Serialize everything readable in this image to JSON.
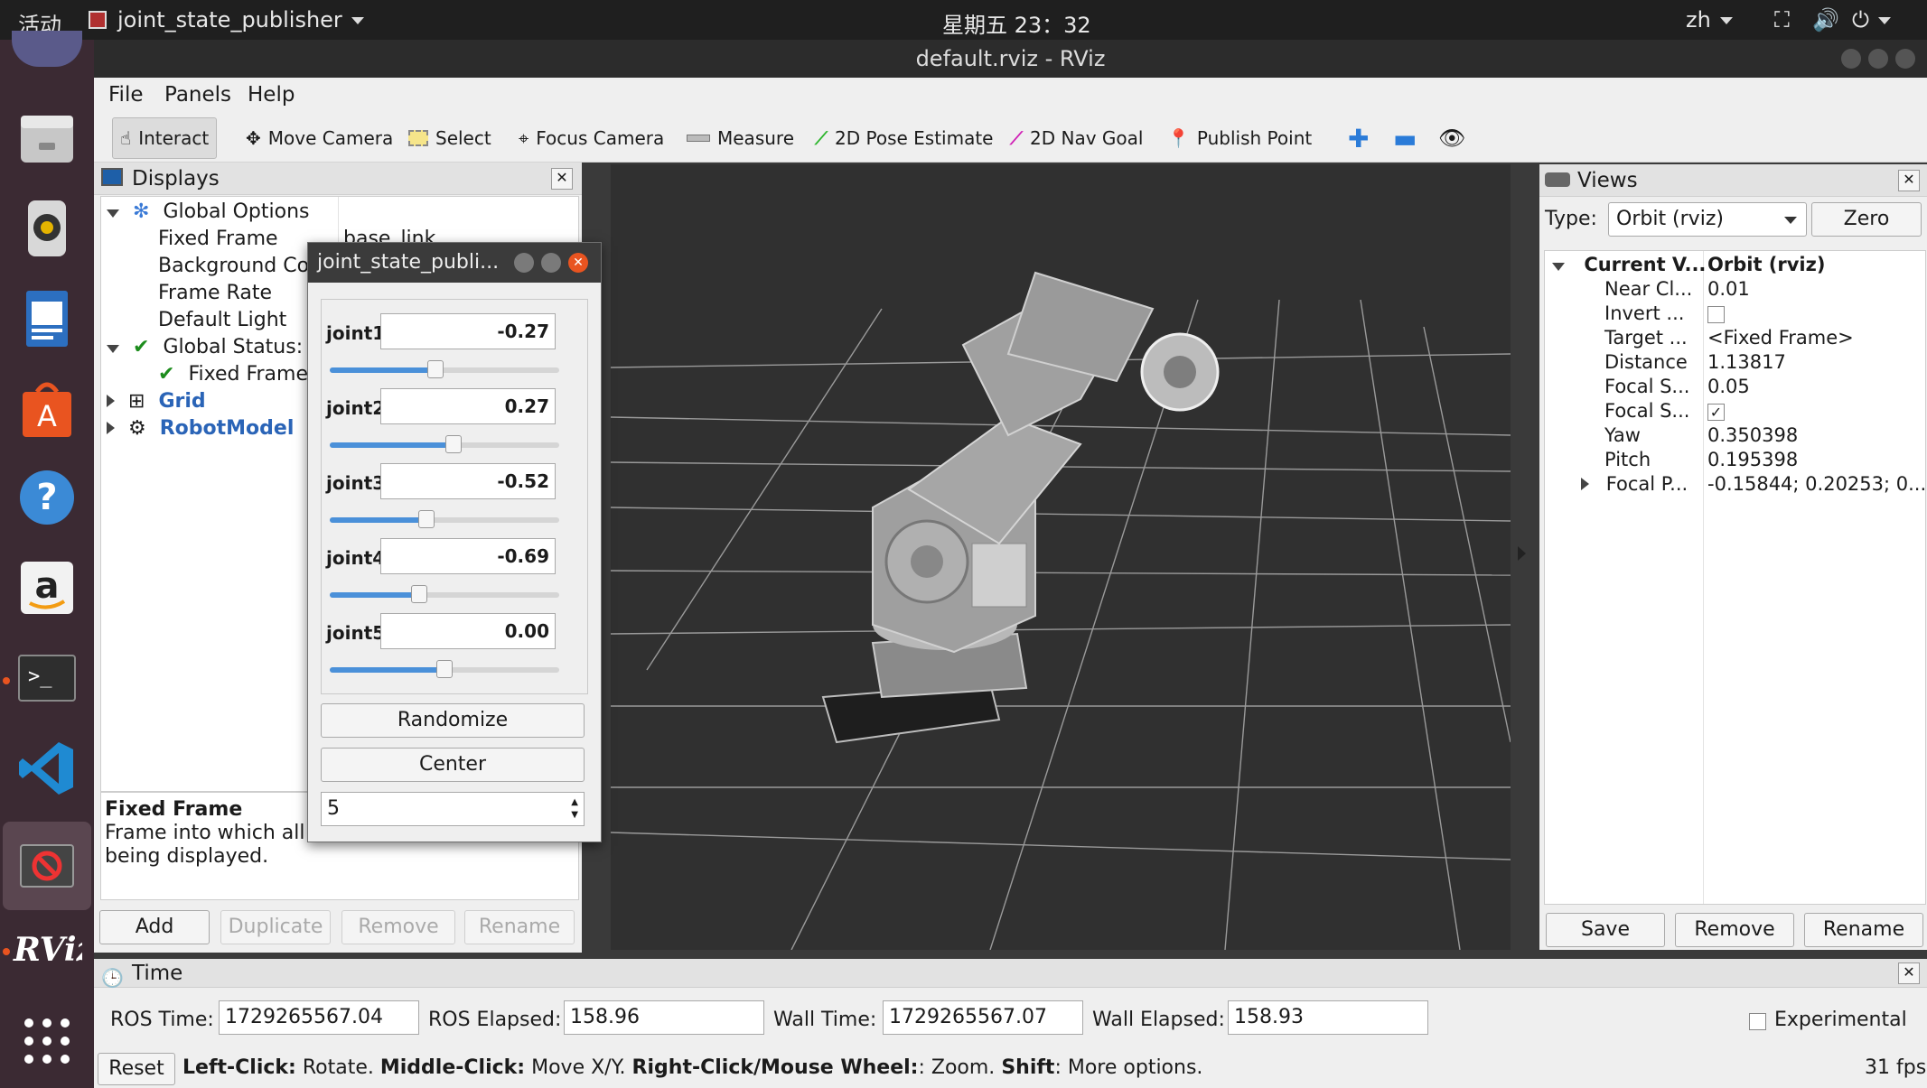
{
  "topbar": {
    "activities": "活动",
    "app_name": "joint_state_publisher",
    "clock": "星期五 23：32",
    "lang": "zh"
  },
  "window": {
    "title": "default.rviz - RViz"
  },
  "menu": [
    "File",
    "Panels",
    "Help"
  ],
  "toolbar": [
    "Interact",
    "Move Camera",
    "Select",
    "Focus Camera",
    "Measure",
    "2D Pose Estimate",
    "2D Nav Goal",
    "Publish Point"
  ],
  "displays": {
    "title": "Displays",
    "items": {
      "global_options": "Global Options",
      "fixed_frame": "Fixed Frame",
      "fixed_frame_value": "base_link",
      "background_color": "Background Col",
      "frame_rate": "Frame Rate",
      "default_light": "Default Light",
      "global_status": "Global Status: C",
      "status_fixed_frame": "Fixed Frame",
      "grid": "Grid",
      "robot_model": "RobotModel"
    },
    "desc_title": "Fixed Frame",
    "desc_text_1": "Frame into which all c",
    "desc_text_2": "being displayed.",
    "buttons": {
      "add": "Add",
      "duplicate": "Duplicate",
      "remove": "Remove",
      "rename": "Rename"
    }
  },
  "jsp": {
    "title": "joint_state_publi...",
    "joints": [
      {
        "name": "joint1",
        "value": "-0.27",
        "level": 0.46
      },
      {
        "name": "joint2",
        "value": "0.27",
        "level": 0.54
      },
      {
        "name": "joint3",
        "value": "-0.52",
        "level": 0.42
      },
      {
        "name": "joint4",
        "value": "-0.69",
        "level": 0.39
      },
      {
        "name": "joint5",
        "value": "0.00",
        "level": 0.5
      }
    ],
    "randomize": "Randomize",
    "center": "Center",
    "spin_value": "5"
  },
  "views": {
    "title": "Views",
    "type_label": "Type:",
    "type_value": "Orbit (rviz)",
    "zero": "Zero",
    "rows": [
      {
        "key": "Current V...",
        "val": "Orbit (rviz)"
      },
      {
        "key": "Near Cl...",
        "val": "0.01"
      },
      {
        "key": "Invert ...",
        "val": ""
      },
      {
        "key": "Target ...",
        "val": "<Fixed Frame>"
      },
      {
        "key": "Distance",
        "val": "1.13817"
      },
      {
        "key": "Focal S...",
        "val": "0.05"
      },
      {
        "key": "Focal S...",
        "val": ""
      },
      {
        "key": "Yaw",
        "val": "0.350398"
      },
      {
        "key": "Pitch",
        "val": "0.195398"
      },
      {
        "key": "Focal P...",
        "val": "-0.15844; 0.20253; 0..."
      }
    ],
    "buttons": {
      "save": "Save",
      "remove": "Remove",
      "rename": "Rename"
    }
  },
  "time": {
    "title": "Time",
    "ros_time_label": "ROS Time:",
    "ros_time": "1729265567.04",
    "ros_elapsed_label": "ROS Elapsed:",
    "ros_elapsed": "158.96",
    "wall_time_label": "Wall Time:",
    "wall_time": "1729265567.07",
    "wall_elapsed_label": "Wall Elapsed:",
    "wall_elapsed": "158.93",
    "experimental": "Experimental"
  },
  "status": {
    "reset": "Reset",
    "h1": "Left-Click:",
    "t1": " Rotate. ",
    "h2": "Middle-Click:",
    "t2": " Move X/Y. ",
    "h3": "Right-Click/Mouse Wheel:",
    "t3": ": Zoom. ",
    "h4": "Shift",
    "t4": ": More options.",
    "fps": "31 fps"
  },
  "colors": {
    "viewport_bg": "#303030",
    "accent": "#2a64b7",
    "ubuntu_orange": "#e95420"
  }
}
